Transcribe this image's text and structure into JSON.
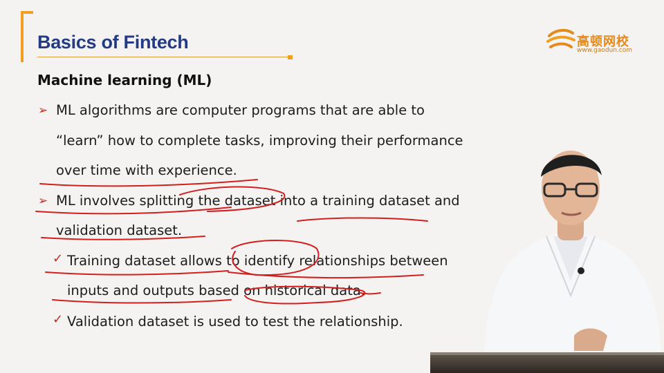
{
  "slide": {
    "title": "Basics of Fintech",
    "logo": {
      "name_cn": "高顿网校",
      "url": "www.gaodun.com"
    },
    "heading": "Machine learning (ML)",
    "bullets": [
      {
        "marker": "arrow-icon",
        "lines": [
          "ML algorithms are computer programs that are able to",
          "“learn” how to complete tasks, improving their performance",
          "over time with experience."
        ]
      },
      {
        "marker": "arrow-icon",
        "lines": [
          "ML involves splitting the dataset into a training dataset and",
          "validation dataset."
        ]
      }
    ],
    "subbullets": [
      {
        "marker": "check-icon",
        "lines": [
          "Training dataset allows to identify relationships between",
          "inputs and outputs based on historical data."
        ]
      },
      {
        "marker": "check-icon",
        "lines": [
          "Validation dataset is used to test the relationship."
        ]
      }
    ]
  },
  "colors": {
    "title": "#233b86",
    "accent": "#f0a020",
    "marker": "#c6281d",
    "ink": "#d21e1e",
    "background": "#f4f3f1"
  }
}
